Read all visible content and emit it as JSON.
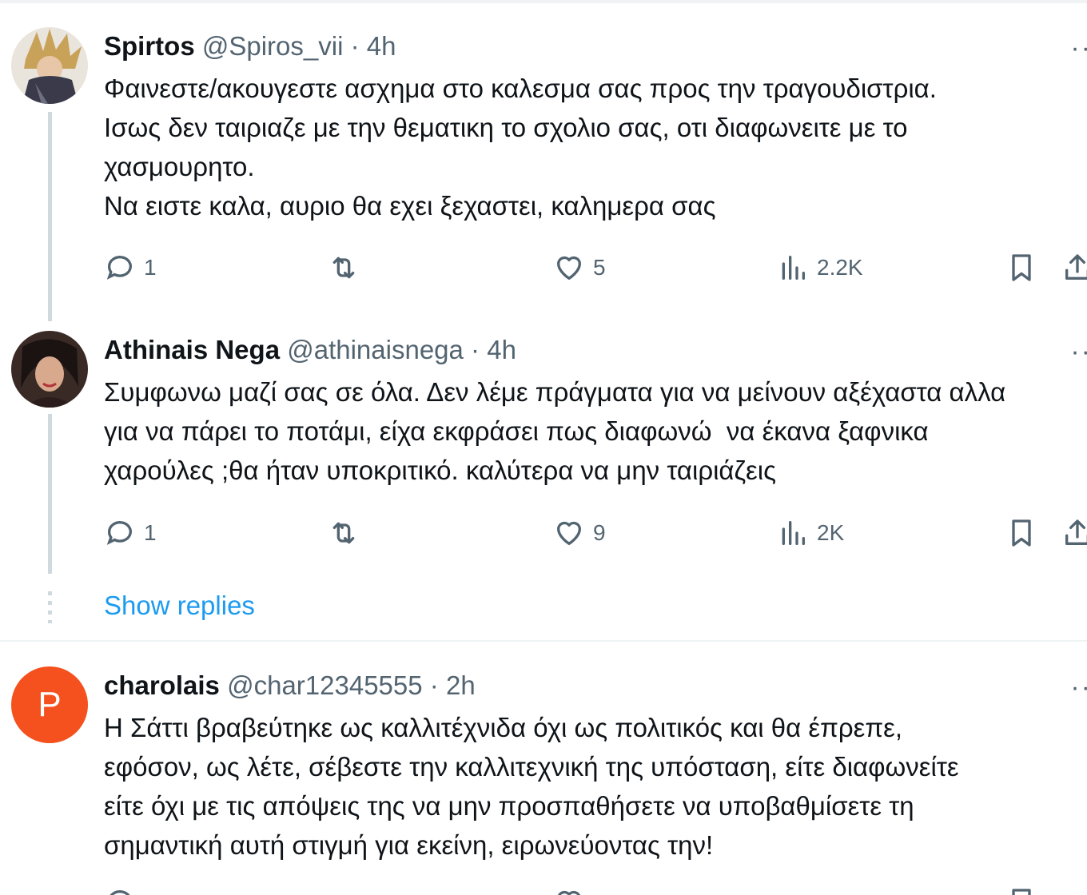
{
  "tweets": [
    {
      "name": "Spirtos",
      "handle": "@Spiros_vii",
      "dot": "·",
      "time": "4h",
      "text": "Φαινεστε/ακουγεστε ασχημα στο καλεσμα σας προς την τραγουδιστρια.\nΙσως δεν ταιριαζε με την θεματικη το σχολιο σας, οτι διαφωνειτε με το\nχασμουρητο.\nΝα ειστε καλα, αυριο θα εχει ξεχαστει, καλημερα σας",
      "replies": "1",
      "likes": "5",
      "views": "2.2K"
    },
    {
      "name": "Athinais Nega",
      "handle": "@athinaisnega",
      "dot": "·",
      "time": "4h",
      "text": "Συμφωνω μαζί σας σε όλα. Δεν λέμε πράγματα για να μείνουν αξέχαστα αλλα\nγια να πάρει το ποτάμι, είχα εκφράσει πως διαφωνώ  να έκανα ξαφνικα\nχαρούλες ;θα ήταν υποκριτικό. καλύτερα να μην ταιριάζεις",
      "replies": "1",
      "likes": "9",
      "views": "2K"
    },
    {
      "name": "charolais",
      "handle": "@char12345555",
      "dot": "·",
      "time": "2h",
      "avatar_letter": "P",
      "avatar_color": "#f4511e",
      "text": "Η Σάττι βραβεύτηκε ως καλλιτέχνιδα όχι ως πολιτικός και θα έπρεπε,\nεφόσον, ως λέτε, σέβεστε την καλλιτεχνική της υπόσταση, είτε διαφωνείτε\nείτε όχι με τις απόψεις της να μην προσπαθήσετε να υποβαθμίσετε τη\nσημαντική αυτή στιγμή για εκείνη, ειρωνεύοντας την!"
    }
  ],
  "show_replies": "Show replies",
  "more_glyph": "··",
  "colors": {
    "link": "#1d9bf0",
    "muted": "#536471",
    "text": "#0f1419",
    "line": "#cfd9de"
  }
}
